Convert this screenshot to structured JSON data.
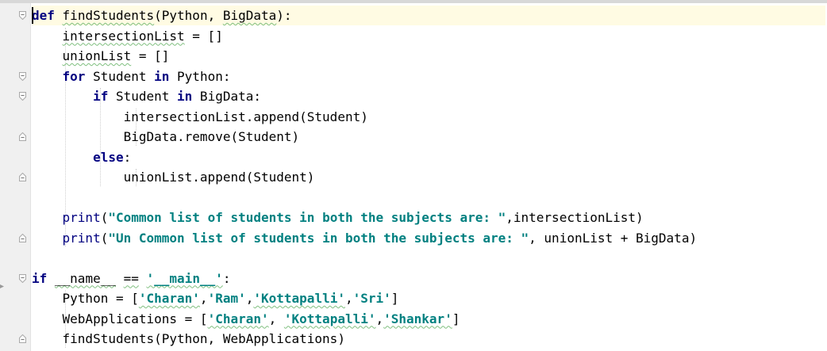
{
  "editor": {
    "language": "python",
    "lines": [
      [
        {
          "t": "def",
          "c": "kw"
        },
        {
          "t": " "
        },
        {
          "t": "findStudents",
          "c": "sq"
        },
        {
          "t": "(Python, "
        },
        {
          "t": "BigData",
          "c": "sq"
        },
        {
          "t": "):"
        }
      ],
      [
        {
          "t": "    "
        },
        {
          "t": "intersectionList",
          "c": "sq"
        },
        {
          "t": " = []"
        }
      ],
      [
        {
          "t": "    "
        },
        {
          "t": "unionList",
          "c": "sq"
        },
        {
          "t": " = []"
        }
      ],
      [
        {
          "t": "    "
        },
        {
          "t": "for",
          "c": "kw"
        },
        {
          "t": " Student "
        },
        {
          "t": "in",
          "c": "kw"
        },
        {
          "t": " Python:"
        }
      ],
      [
        {
          "t": "        "
        },
        {
          "t": "if",
          "c": "kw"
        },
        {
          "t": " Student "
        },
        {
          "t": "in",
          "c": "kw"
        },
        {
          "t": " BigData:"
        }
      ],
      [
        {
          "t": "            intersectionList.append(Student)"
        }
      ],
      [
        {
          "t": "            BigData.remove(Student)"
        }
      ],
      [
        {
          "t": "        "
        },
        {
          "t": "else",
          "c": "kw"
        },
        {
          "t": ":"
        }
      ],
      [
        {
          "t": "            unionList.append(Student)"
        }
      ],
      [],
      [
        {
          "t": "    "
        },
        {
          "t": "print",
          "c": "builtin"
        },
        {
          "t": "("
        },
        {
          "t": "\"Common list of students in both the subjects are: \"",
          "c": "str"
        },
        {
          "t": ","
        },
        {
          "t": "intersectionList)"
        }
      ],
      [
        {
          "t": "    "
        },
        {
          "t": "print",
          "c": "builtin"
        },
        {
          "t": "("
        },
        {
          "t": "\"Un Common list of students in both the subjects are: \"",
          "c": "str"
        },
        {
          "t": ", unionList + BigData)"
        }
      ],
      [],
      [
        {
          "t": "if",
          "c": "kw"
        },
        {
          "t": " "
        },
        {
          "t": "__name__",
          "c": "sq"
        },
        {
          "t": " "
        },
        {
          "t": "==",
          "c": "sq"
        },
        {
          "t": " "
        },
        {
          "t": "'__main__'",
          "c": "str sq"
        },
        {
          "t": ":"
        }
      ],
      [
        {
          "t": "    Python = ["
        },
        {
          "t": "'Charan'",
          "c": "str sq"
        },
        {
          "t": ","
        },
        {
          "t": "'Ram'",
          "c": "str"
        },
        {
          "t": ","
        },
        {
          "t": "'Kottapalli'",
          "c": "str sq"
        },
        {
          "t": ","
        },
        {
          "t": "'Sri'",
          "c": "str"
        },
        {
          "t": "]"
        }
      ],
      [
        {
          "t": "    WebApplications = ["
        },
        {
          "t": "'Charan'",
          "c": "str sq"
        },
        {
          "t": ", "
        },
        {
          "t": "'Kottapalli'",
          "c": "str sq"
        },
        {
          "t": ","
        },
        {
          "t": "'Shankar'",
          "c": "str sq"
        },
        {
          "t": "]"
        }
      ],
      [
        {
          "t": "    findStudents(Python, WebApplications)"
        }
      ]
    ]
  },
  "colors": {
    "keyword": "#000080",
    "string": "#008080",
    "current_line": "#fffbe3",
    "gutter": "#f0f0f0"
  },
  "gutter_icons": [
    "fold-open-icon",
    "fold-close-icon",
    "breakpoint-marker-icon"
  ]
}
